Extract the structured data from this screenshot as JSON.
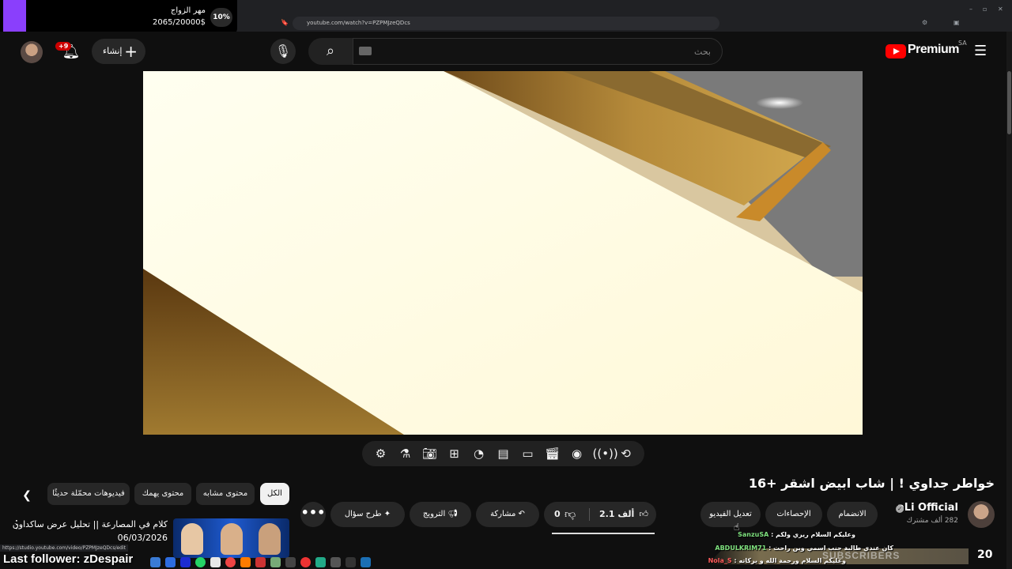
{
  "browser": {
    "url": "youtube.com/watch?v=PZPMJzeQDcs",
    "status_url": "https://studio.youtube.com/video/PZPMJzeQDcs/edit"
  },
  "donation_goal": {
    "title": "مهر الزواج",
    "amount": "2065/20000$",
    "percent": "10%",
    "progress": 0.1
  },
  "header": {
    "notification_badge": "+9",
    "create_label": "إنشاء",
    "search_placeholder": "بحث",
    "logo_word": "Premium",
    "country_code": "SA"
  },
  "player_toolbar": {
    "icons": [
      "gear-icon",
      "flask-icon",
      "camera-icon",
      "add-box-icon",
      "speedometer-icon",
      "subtitles-icon",
      "crop-icon",
      "clapperboard-icon",
      "screen-eye-icon",
      "broadcast-icon",
      "loop-icon"
    ]
  },
  "video": {
    "title": "خواطر جداوي ! | شاب ابيض اشقر +16"
  },
  "channel": {
    "name": "aLi Official",
    "subscribers": "282 ألف مشترك",
    "join_label": "الانضمام",
    "stats_label": "الإحصاءات",
    "edit_label": "تعديل الفيديو"
  },
  "actions": {
    "likes": "2.1 ألف",
    "dislikes": "0",
    "share_label": "مشاركة",
    "promote_label": "الترويج",
    "ask_label": "طرح سؤال",
    "more_label": "•••"
  },
  "chips": {
    "all": "الكل",
    "similar": "محتوى مشابه",
    "interests": "محتوى يهمك",
    "new": "فيديوهات محمّلة حديثًا"
  },
  "recommended": {
    "title": "كلام في المصارعة || تحليل عرض ساكداون",
    "date": "06/03/2026"
  },
  "overlay": {
    "last_follower": "Last follower: zDespair",
    "subs_label": "SUBSCRIBERS",
    "subs_count": "20",
    "chat": [
      {
        "name": "SanzuSA",
        "text": "وعليكم السلام ريري ولكم"
      },
      {
        "name": "ABDULKRIM71",
        "text": "كان عندي طالبة جنب اسمي وين راحت"
      },
      {
        "name": "Nola_S",
        "text": "وعليكم السلام ورحمة الله و بركاته"
      }
    ]
  },
  "colors": {
    "background": "#0f0f0f",
    "pill": "#272727",
    "youtube_red": "#ff0000",
    "donation_accent": "#8a3ffc"
  }
}
